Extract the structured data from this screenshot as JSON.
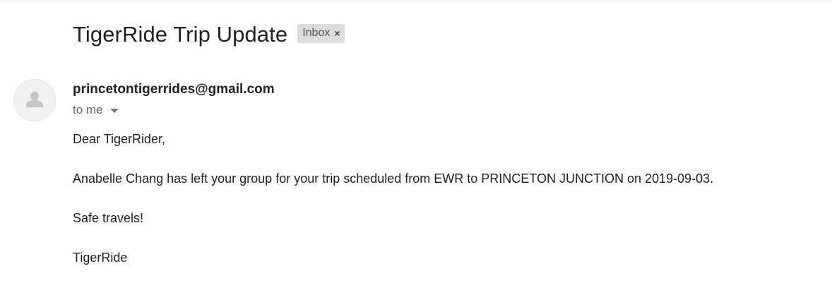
{
  "email": {
    "subject": "TigerRide Trip Update",
    "label": "Inbox",
    "label_remove_glyph": "×",
    "sender": "princetontigerrides@gmail.com",
    "recipient_text": "to me",
    "body": {
      "greeting": "Dear TigerRider,",
      "message": "Anabelle Chang has left your group for your trip scheduled from EWR to PRINCETON JUNCTION on 2019-09-03.",
      "closing": "Safe travels!",
      "signature": "TigerRide"
    }
  },
  "icons": {
    "avatar": "person-icon",
    "recipient_dropdown": "caret-down-icon",
    "label_remove": "close-icon"
  },
  "colors": {
    "text": "#222222",
    "secondary_text": "#666666",
    "chip_background": "#dddddd",
    "avatar_background": "#f1f1f1",
    "avatar_glyph": "#c5c5c5"
  }
}
